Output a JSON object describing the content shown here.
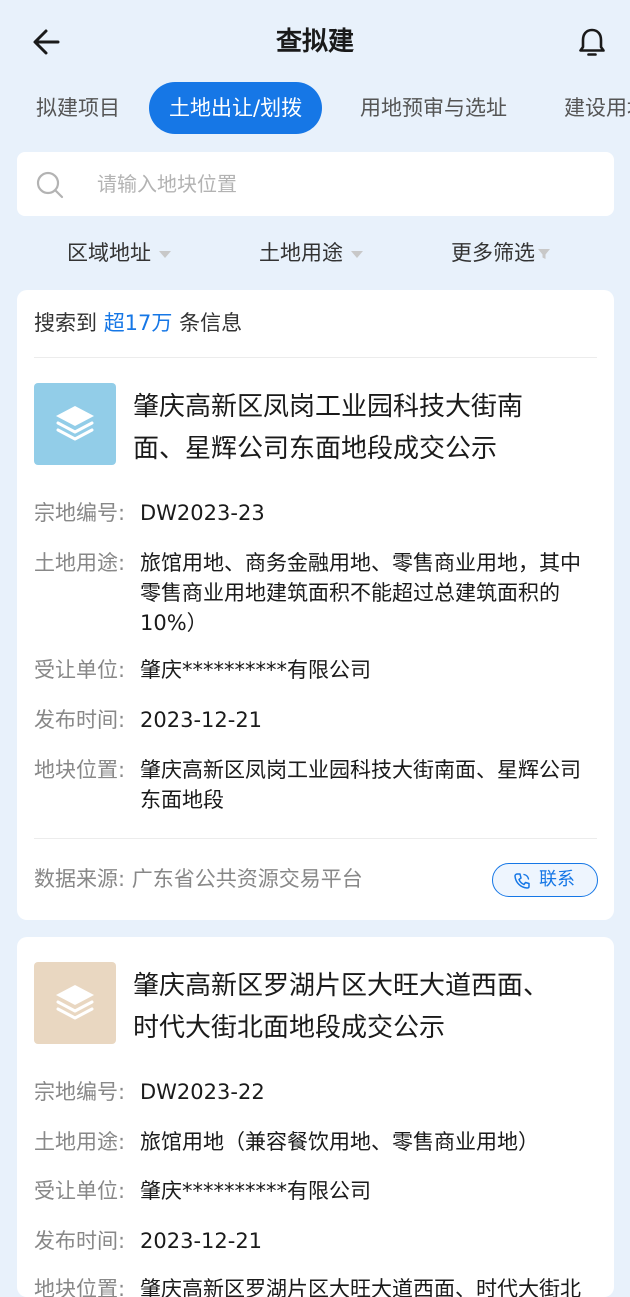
{
  "header": {
    "title": "查拟建"
  },
  "tabs": [
    {
      "label": "拟建项目"
    },
    {
      "label": "土地出让/划拨"
    },
    {
      "label": "用地预审与选址"
    },
    {
      "label": "建设用地"
    }
  ],
  "search": {
    "placeholder": "请输入地块位置"
  },
  "filters": [
    {
      "label": "区域地址"
    },
    {
      "label": "土地用途"
    },
    {
      "label": "更多筛选"
    }
  ],
  "results": {
    "prefix": "搜索到",
    "count": "超17万",
    "suffix": "条信息"
  },
  "labels": {
    "parcel_no": "宗地编号:",
    "land_use": "土地用途:",
    "transferee": "受让单位:",
    "publish_time": "发布时间:",
    "location": "地块位置:"
  },
  "items": [
    {
      "title": "肇庆高新区凤岗工业园科技大街南面、星辉公司东面地段成交公示",
      "thumb_color": "#92cde8",
      "parcel_no": "DW2023-23",
      "land_use": "旅馆用地、商务金融用地、零售商业用地，其中零售商业用地建筑面积不能超过总建筑面积的10%）",
      "transferee": "肇庆**********有限公司",
      "publish_time": "2023-12-21",
      "location": "肇庆高新区凤岗工业园科技大街南面、星辉公司东面地段",
      "source": "数据来源: 广东省公共资源交易平台",
      "contact_label": "联系"
    },
    {
      "title": "肇庆高新区罗湖片区大旺大道西面、时代大街北面地段成交公示",
      "thumb_color": "#e9d7c1",
      "parcel_no": "DW2023-22",
      "land_use": "旅馆用地（兼容餐饮用地、零售商业用地）",
      "transferee": "肇庆**********有限公司",
      "publish_time": "2023-12-21",
      "location": "肇庆高新区罗湖片区大旺大道西面、时代大街北面地段"
    }
  ],
  "colors": {
    "accent": "#1677e6",
    "background": "#e8f1fb"
  }
}
